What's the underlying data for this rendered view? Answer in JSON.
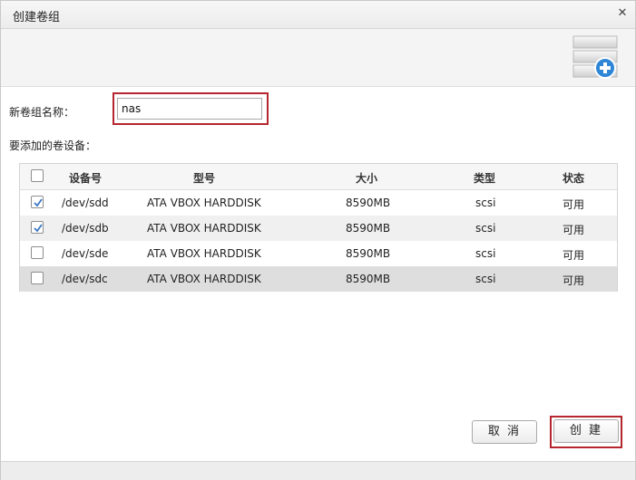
{
  "dialog": {
    "title": "创建卷组"
  },
  "form": {
    "name_label": "新卷组名称：",
    "name_value": "nas",
    "devices_label": "要添加的卷设备："
  },
  "table": {
    "columns": [
      "设备号",
      "型号",
      "大小",
      "类型",
      "状态"
    ],
    "rows": [
      {
        "checked": true,
        "device": "/dev/sdd",
        "model": "ATA VBOX HARDDISK",
        "size": "8590MB",
        "type": "scsi",
        "status": "可用"
      },
      {
        "checked": true,
        "device": "/dev/sdb",
        "model": "ATA VBOX HARDDISK",
        "size": "8590MB",
        "type": "scsi",
        "status": "可用"
      },
      {
        "checked": false,
        "device": "/dev/sde",
        "model": "ATA VBOX HARDDISK",
        "size": "8590MB",
        "type": "scsi",
        "status": "可用"
      },
      {
        "checked": false,
        "device": "/dev/sdc",
        "model": "ATA VBOX HARDDISK",
        "size": "8590MB",
        "type": "scsi",
        "status": "可用"
      }
    ]
  },
  "buttons": {
    "cancel": "取 消",
    "create": "创 建"
  },
  "icons": {
    "close": "close-icon",
    "banner": "volume-add-icon",
    "check": "checkmark-icon"
  },
  "colors": {
    "highlight_border": "#b5262f",
    "check": "#3a76c4",
    "add_badge": "#2f86d6"
  }
}
